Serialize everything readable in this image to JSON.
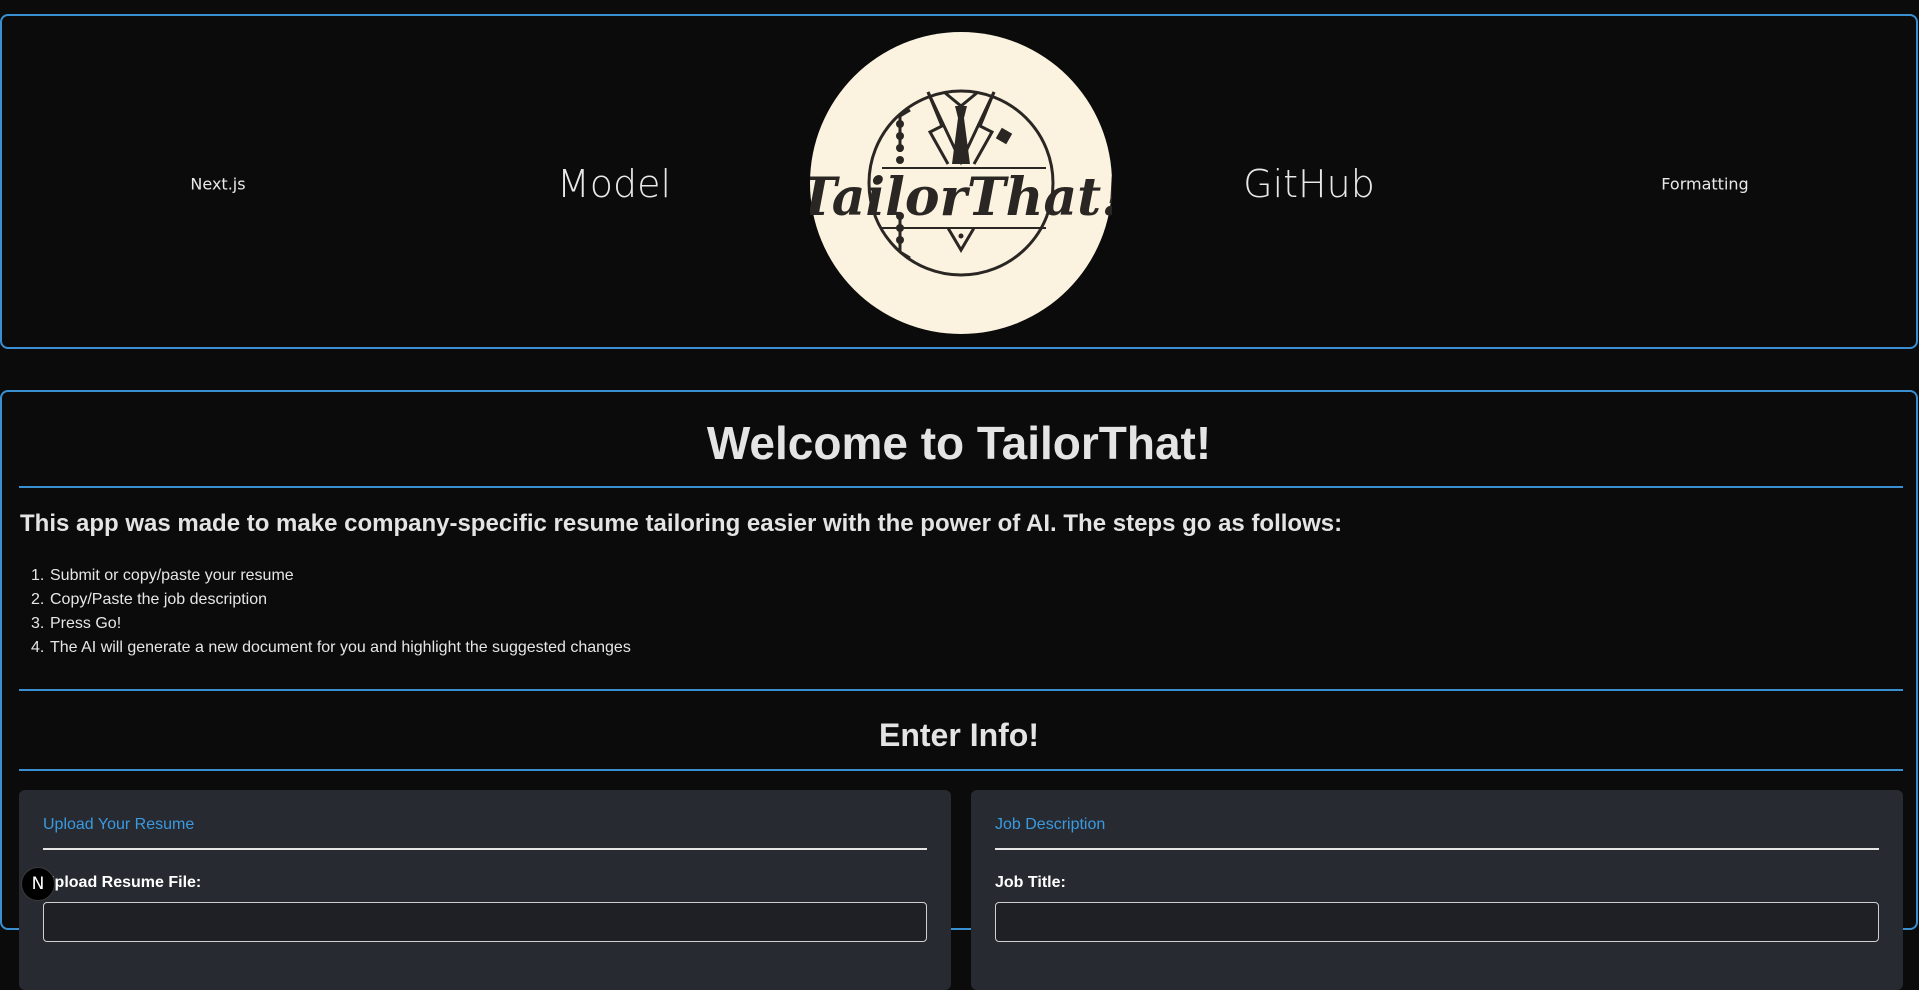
{
  "nav": {
    "left_small": "Next.js",
    "left_large": "Model",
    "right_large": "GitHub",
    "right_small": "Formatting"
  },
  "logo": {
    "text": "TailorThat!"
  },
  "main": {
    "title": "Welcome to TailorThat!",
    "intro": "This app was made to make company-specific resume tailoring easier with the power of AI. The steps go as follows:",
    "steps": [
      {
        "num": "1.",
        "text": "Submit or copy/paste your resume"
      },
      {
        "num": "2.",
        "text": "Copy/Paste the job description"
      },
      {
        "num": "3.",
        "text": "Press Go!"
      },
      {
        "num": "4.",
        "text": "The AI will generate a new document for you and highlight the suggested changes"
      }
    ],
    "enter_title": "Enter Info!"
  },
  "resume_card": {
    "title": "Upload Your Resume",
    "field_label": "Upload Resume File:"
  },
  "job_card": {
    "title": "Job Description",
    "field_label": "Job Title:"
  },
  "dev_badge": {
    "glyph": "N"
  },
  "colors": {
    "background": "#0b0b0c",
    "accent_border": "#3a8fd0",
    "card_background": "#272a31",
    "card_title": "#3a9ae0",
    "logo_fill": "#fbf3df",
    "logo_ink": "#2a2623"
  }
}
